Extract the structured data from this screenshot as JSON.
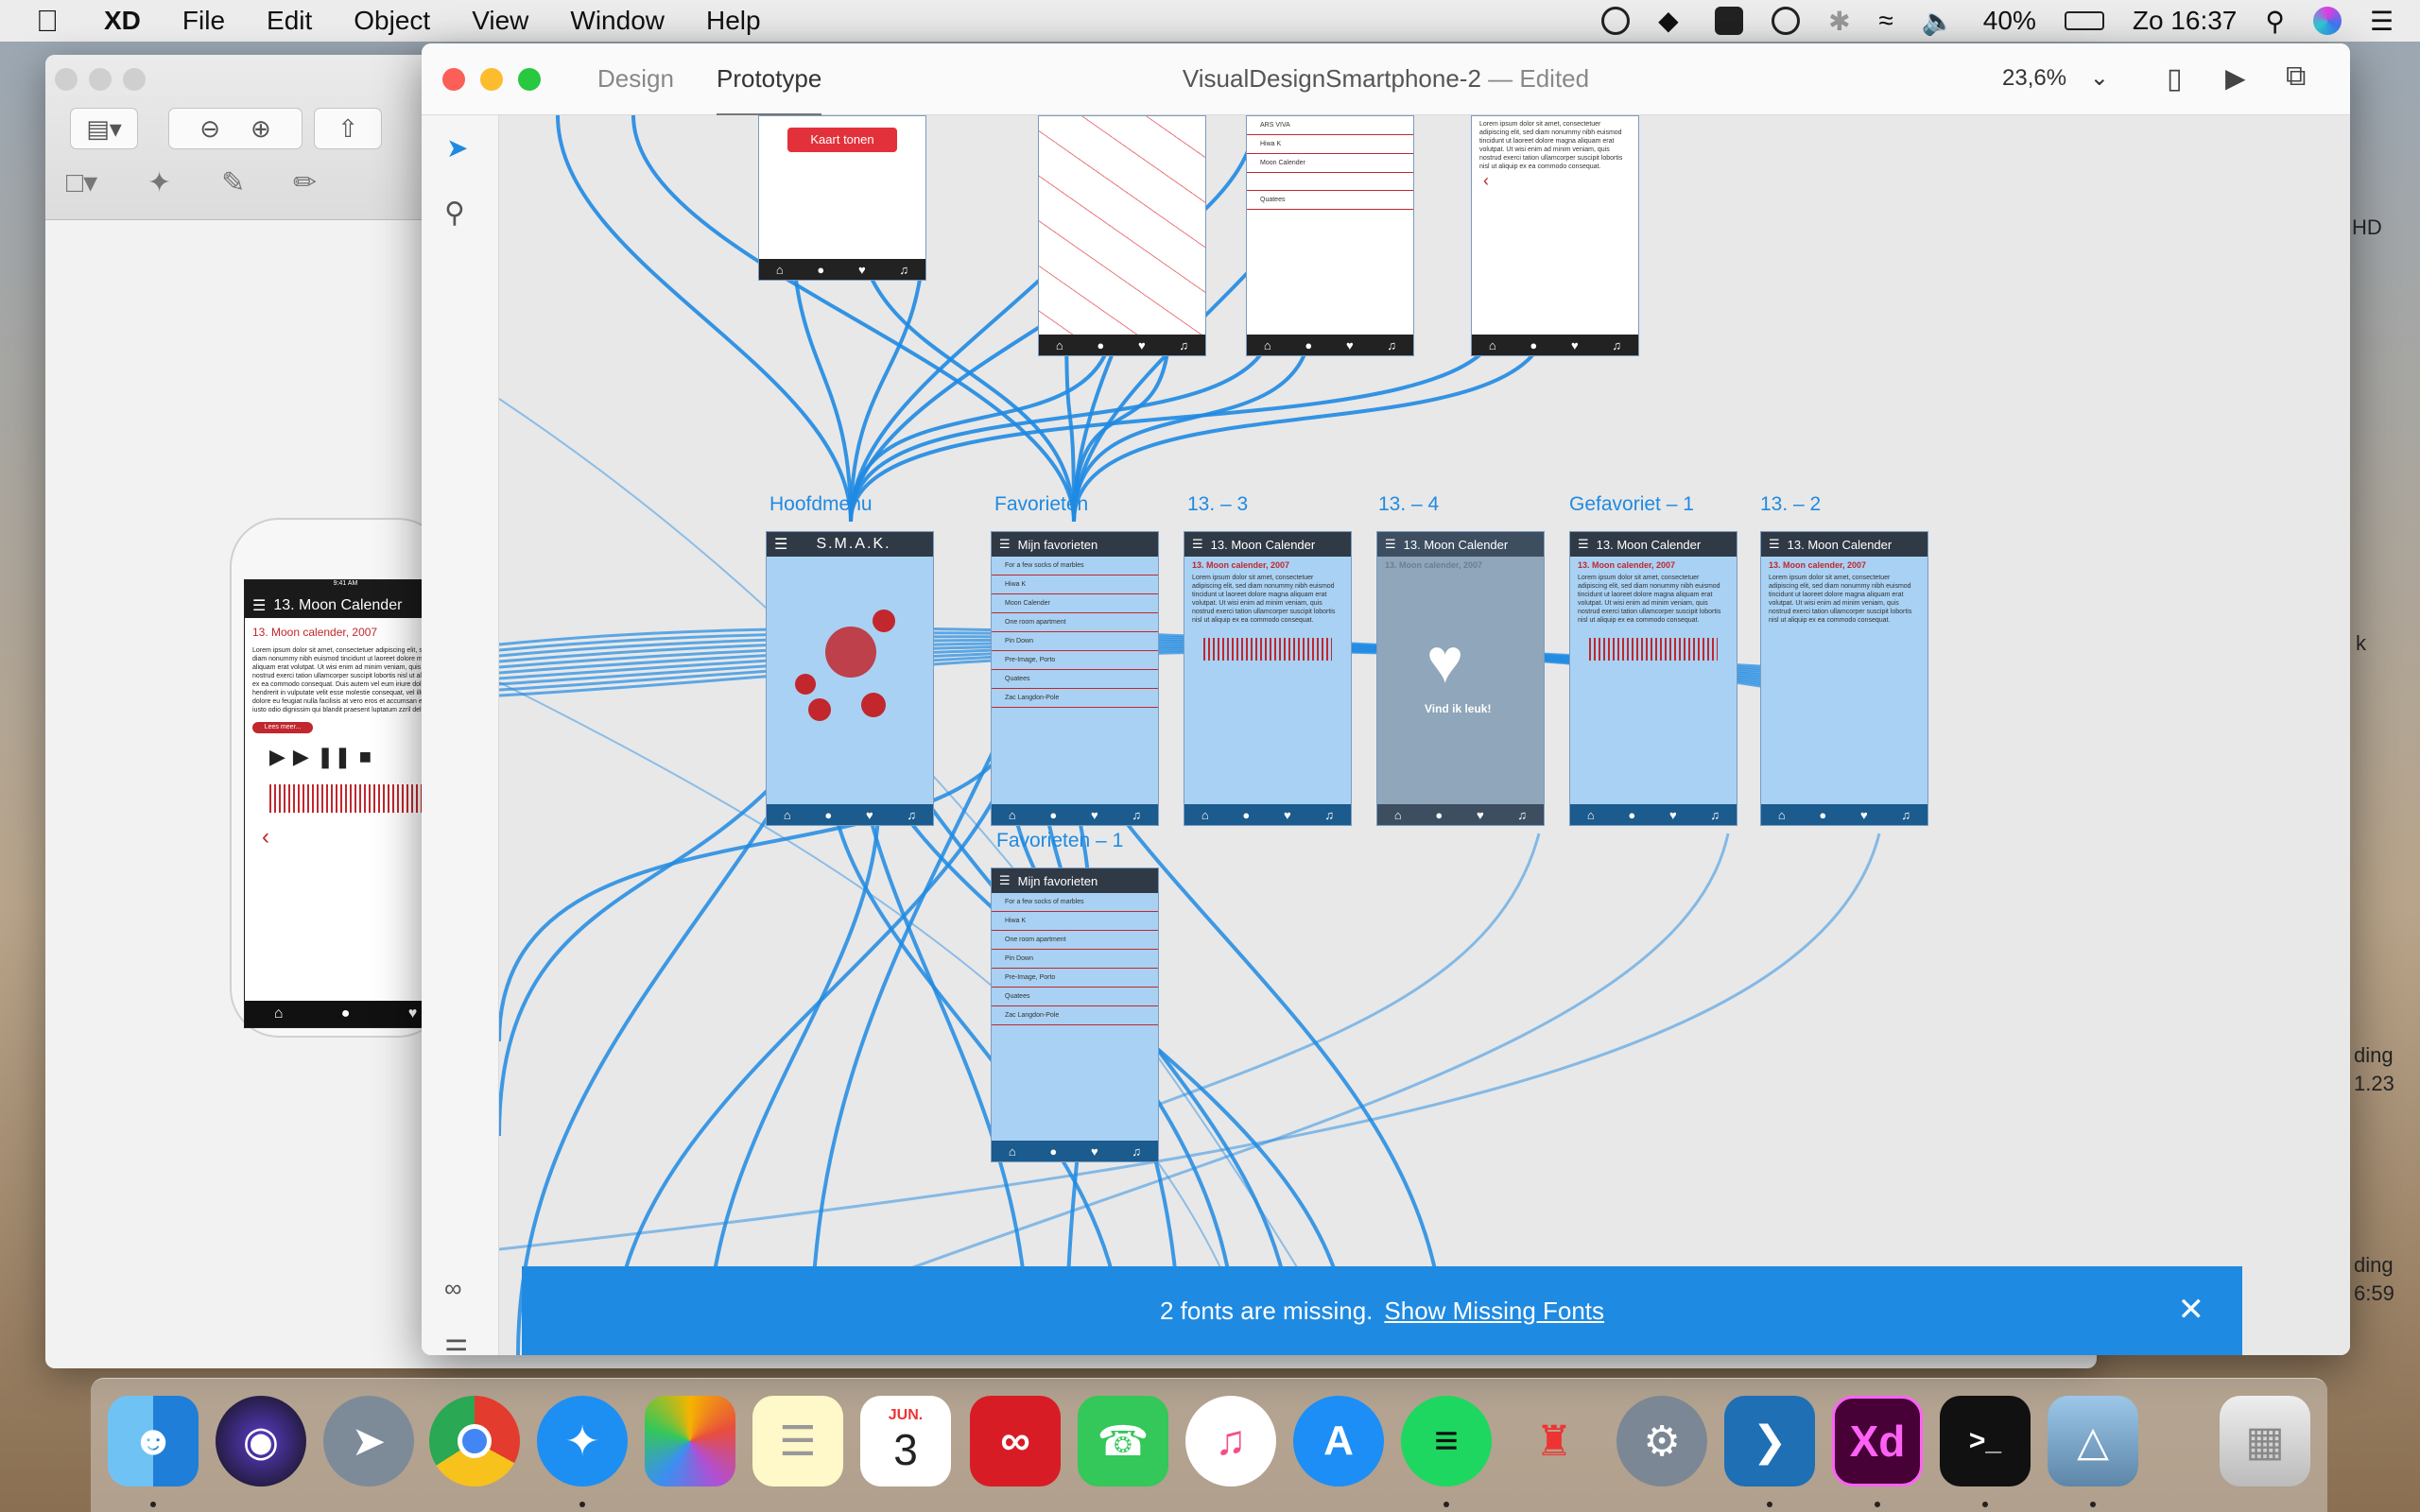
{
  "menubar": {
    "app_name": "XD",
    "items": [
      "File",
      "Edit",
      "Object",
      "View",
      "Window",
      "Help"
    ],
    "battery": "40%",
    "clock": "Zo 16:37"
  },
  "preview": {
    "phone": {
      "status_time": "9:41 AM",
      "title": "13. Moon Calender",
      "subtitle": "13. Moon calender, 2007",
      "body": "Lorem ipsum dolor sit amet, consectetuer adipiscing elit, sed diam nonummy nibh euismod tincidunt ut laoreet dolore magna aliquam erat volutpat. Ut wisi enim ad minim veniam, quis nostrud exerci tation ullamcorper suscipit lobortis nisl ut aliquip ex ea commodo consequat. Duis autem vel eum iriure dolor in hendrerit in vulputate velit esse molestie consequat, vel illum dolore eu feugiat nulla facilisis at vero eros et accumsan et iusto odio dignissim qui blandit praesent luptatum zzril delenit.",
      "read_more": "Lees meer..."
    }
  },
  "xd": {
    "tabs": [
      "Design",
      "Prototype"
    ],
    "active_tab": "Prototype",
    "document_title": "VisualDesignSmartphone-2",
    "document_status": "— Edited",
    "zoom": "23,6%",
    "artboards": [
      {
        "label": "Hoofdmenu",
        "header": "S.M.A.K."
      },
      {
        "label": "Favorieten",
        "header": "Mijn favorieten"
      },
      {
        "label": "13. – 3",
        "header": "13. Moon Calender"
      },
      {
        "label": "13. – 4",
        "header": "13. Moon Calender"
      },
      {
        "label": "Gefavoriet – 1",
        "header": "13. Moon Calender"
      },
      {
        "label": "13. – 2",
        "header": "13. Moon Calender"
      },
      {
        "label": "Favorieten – 1",
        "header": "Mijn favorieten"
      }
    ],
    "top_artboard_button": "Kaart tonen",
    "top_list_rows": [
      "ARS VIVA",
      "Hiwa K",
      "Moon Calender",
      "",
      "Quatees"
    ],
    "favorites_rows": [
      "For a few socks of marbles",
      "Hiwa K",
      "Moon Calender",
      "One room apartment",
      "Pin Down",
      "Pre-Image, Porto",
      "Quatees",
      "Zac Langdon-Pole"
    ],
    "calendar_subtitle": "13. Moon calender, 2007",
    "calendar_para": "Lorem ipsum dolor sit amet, consectetuer adipiscing elit, sed diam nonummy nibh euismod tincidunt ut laoreet dolore magna aliquam erat volutpat. Ut wisi enim ad minim veniam, quis nostrud exerci tation ullamcorper suscipit lobortis nisl ut aliquip ex ea commodo consequat.",
    "like_overlay_text": "Vind ik leuk!",
    "banner": {
      "text": "2 fonts are missing.",
      "link": "Show Missing Fonts"
    }
  },
  "desktop_right": {
    "lines": [
      "HD",
      "k",
      "ding",
      "1.23",
      "ding",
      "6:59"
    ]
  },
  "dock": {
    "calendar_month": "JUN.",
    "calendar_day": "3",
    "xd_label": "Xd",
    "apps": [
      "finder-icon",
      "siri-icon",
      "launchpad-icon",
      "chrome-icon",
      "safari-icon",
      "photos-icon",
      "notes-icon",
      "calendar-icon",
      "creative-cloud-icon",
      "facetime-icon",
      "itunes-icon",
      "app-store-icon",
      "spotify-icon",
      "popcorn-time-icon",
      "system-preferences-icon",
      "vscode-icon",
      "adobe-xd-icon",
      "terminal-icon",
      "preview-icon",
      "trash-icon"
    ]
  }
}
